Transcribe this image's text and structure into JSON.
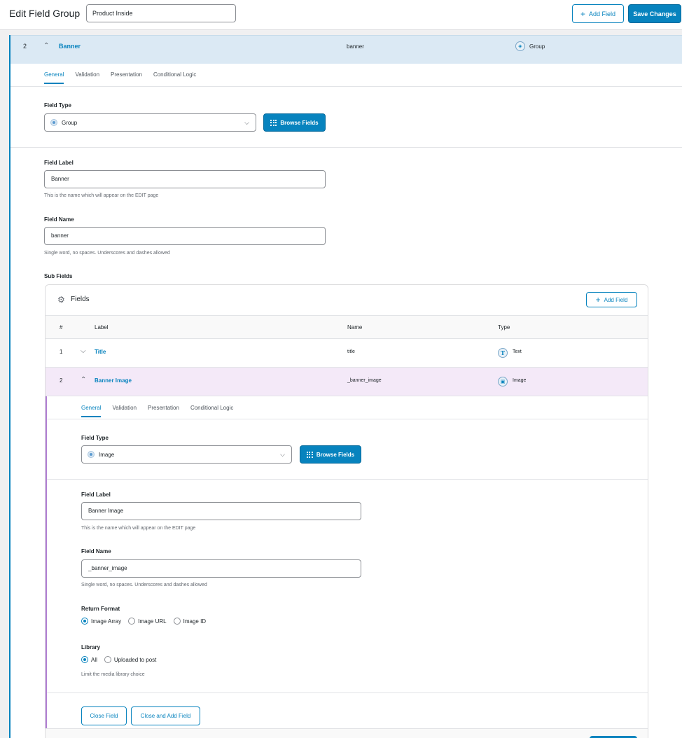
{
  "header": {
    "title": "Edit Field Group",
    "group_title_value": "Product Inside",
    "add_field_label": "Add Field",
    "save_label": "Save Changes"
  },
  "group_row": {
    "order": "2",
    "label": "Banner",
    "name": "banner",
    "type": "Group"
  },
  "tabs": [
    "General",
    "Validation",
    "Presentation",
    "Conditional Logic"
  ],
  "general": {
    "field_type_label": "Field Type",
    "field_type_value": "Group",
    "browse_label": "Browse Fields",
    "field_label_label": "Field Label",
    "field_label_value": "Banner",
    "field_label_help": "This is the name which will appear on the EDIT page",
    "field_name_label": "Field Name",
    "field_name_value": "banner",
    "field_name_help": "Single word, no spaces. Underscores and dashes allowed",
    "sub_fields_label": "Sub Fields"
  },
  "subfields": {
    "title": "Fields",
    "add_field_label": "Add Field",
    "columns": {
      "order": "#",
      "label": "Label",
      "name": "Name",
      "type": "Type"
    },
    "rows": [
      {
        "order": "1",
        "label": "Title",
        "name": "title",
        "type": "Text",
        "icon": "T"
      },
      {
        "order": "2",
        "label": "Banner Image",
        "name": "_banner_image",
        "type": "Image",
        "icon": "image-icon"
      }
    ]
  },
  "sub_general": {
    "field_type_label": "Field Type",
    "field_type_value": "Image",
    "browse_label": "Browse Fields",
    "field_label_label": "Field Label",
    "field_label_value": "Banner Image",
    "field_label_help": "This is the name which will appear on the EDIT page",
    "field_name_label": "Field Name",
    "field_name_value": "_banner_image",
    "field_name_help": "Single word, no spaces. Underscores and dashes allowed",
    "return_format_label": "Return Format",
    "return_options": [
      "Image Array",
      "Image URL",
      "Image ID"
    ],
    "return_selected": "Image Array",
    "library_label": "Library",
    "library_options": [
      "All",
      "Uploaded to post"
    ],
    "library_selected": "All",
    "library_help": "Limit the media library choice",
    "close_label": "Close Field",
    "close_add_label": "Close and Add Field"
  },
  "colors": {
    "accent": "#0783be",
    "group_row_bg": "#dbe9f4",
    "sub_row_bg": "#f4e9f8",
    "sub_border": "#b17ed3"
  }
}
